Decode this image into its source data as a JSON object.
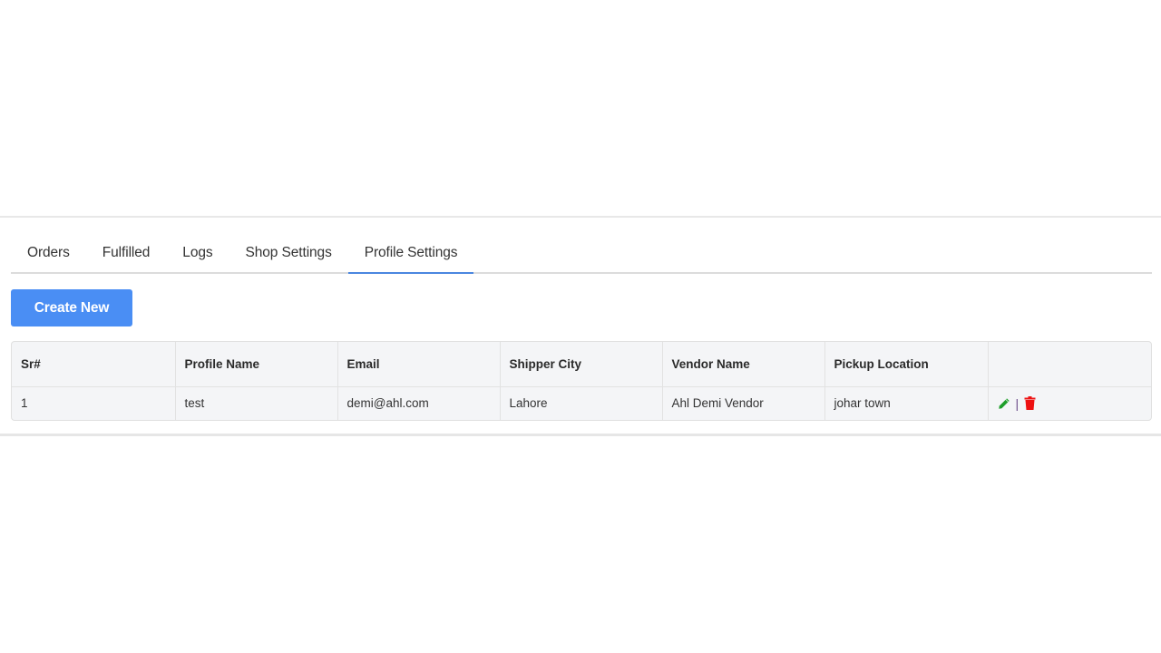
{
  "tabs": [
    {
      "label": "Orders",
      "active": false
    },
    {
      "label": "Fulfilled",
      "active": false
    },
    {
      "label": "Logs",
      "active": false
    },
    {
      "label": "Shop Settings",
      "active": false
    },
    {
      "label": "Profile Settings",
      "active": true
    }
  ],
  "toolbar": {
    "create_label": "Create New"
  },
  "colors": {
    "accent": "#4a8ef4",
    "tab_underline": "#4a86e0",
    "edit_icon": "#1e9e2a",
    "delete_icon": "#ee1111"
  },
  "table": {
    "columns": [
      "Sr#",
      "Profile Name",
      "Email",
      "Shipper City",
      "Vendor Name",
      "Pickup Location",
      ""
    ],
    "rows": [
      {
        "sr": "1",
        "profile_name": "test",
        "email": "demi@ahl.com",
        "shipper_city": "Lahore",
        "vendor_name": "Ahl Demi Vendor",
        "pickup_location": "johar town",
        "actions": {
          "edit_icon": "pencil-icon",
          "separator": "|",
          "delete_icon": "trash-icon"
        }
      }
    ]
  }
}
